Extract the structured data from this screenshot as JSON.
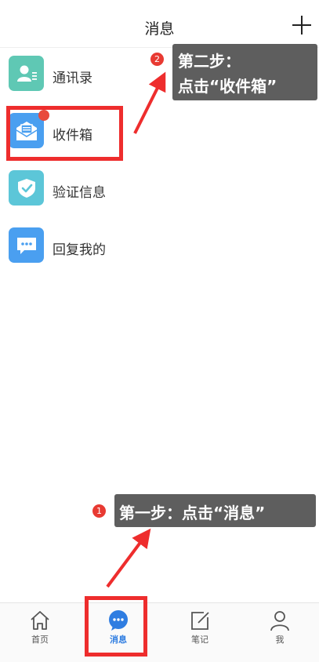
{
  "header": {
    "title": "消息"
  },
  "list": [
    {
      "label": "通讯录",
      "icon": "contacts-icon",
      "color": "#5fc8b4"
    },
    {
      "label": "收件箱",
      "icon": "inbox-icon",
      "color": "#4a9ff0"
    },
    {
      "label": "验证信息",
      "icon": "shield-check-icon",
      "color": "#5cc6d8"
    },
    {
      "label": "回复我的",
      "icon": "chat-bubble-icon",
      "color": "#4a9ff0"
    }
  ],
  "tabs": [
    {
      "label": "首页",
      "icon": "home-icon"
    },
    {
      "label": "消息",
      "icon": "message-icon",
      "active": true
    },
    {
      "label": "笔记",
      "icon": "note-edit-icon"
    },
    {
      "label": "我",
      "icon": "user-icon"
    }
  ],
  "annotations": {
    "step1": {
      "num": "1",
      "text": "第一步：点击“消息”"
    },
    "step2": {
      "num": "2",
      "line1": "第二步：",
      "line2": "点击“收件箱”"
    }
  },
  "colors": {
    "highlight": "#ee2d2d",
    "active_tab": "#2f7de1",
    "callout_bg": "#5e5e5e",
    "badge": "#e84a3b"
  }
}
